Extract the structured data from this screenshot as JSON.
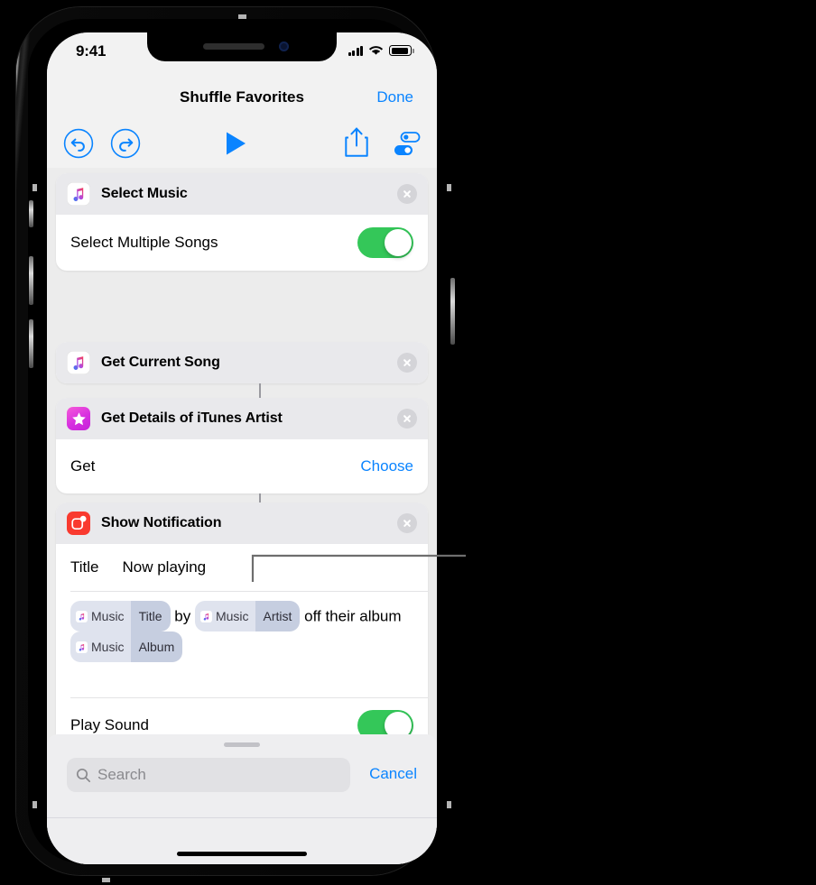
{
  "status_bar": {
    "time": "9:41",
    "cellular_icon": "cellular-signal-icon",
    "wifi_icon": "wifi-icon",
    "battery_icon": "battery-icon"
  },
  "nav": {
    "title": "Shuffle Favorites",
    "done_label": "Done"
  },
  "toolbar": {
    "undo_icon": "undo-icon",
    "redo_icon": "redo-icon",
    "play_icon": "play-icon",
    "share_icon": "share-icon",
    "settings_icon": "settings-toggles-icon",
    "accent_color": "#0a84ff"
  },
  "actions": [
    {
      "id": "select-music",
      "title": "Select Music",
      "icon": "apple-music-icon",
      "rows": [
        {
          "type": "toggle",
          "label": "Select Multiple Songs",
          "value": "on"
        }
      ]
    },
    {
      "id": "get-current-song",
      "title": "Get Current Song",
      "icon": "apple-music-icon",
      "rows": []
    },
    {
      "id": "get-details-itunes-artist",
      "title": "Get Details of iTunes Artist",
      "icon": "itunes-star-icon",
      "rows": [
        {
          "type": "link",
          "label": "Get",
          "link_label": "Choose"
        }
      ]
    },
    {
      "id": "show-notification",
      "title": "Show Notification",
      "icon": "notification-icon",
      "rows": [
        {
          "type": "title",
          "label": "Title",
          "value": "Now playing"
        },
        {
          "type": "toggle",
          "label": "Play Sound",
          "value": "on"
        }
      ]
    }
  ],
  "notification_body": {
    "tokens": [
      {
        "app": "Music",
        "field": "Title"
      },
      {
        "app": "Music",
        "field": "Artist"
      },
      {
        "app": "Music",
        "field": "Album"
      }
    ],
    "text_1": "by",
    "text_2": "off their",
    "text_3": "album"
  },
  "search": {
    "placeholder": "Search",
    "icon": "search-icon",
    "cancel_label": "Cancel"
  },
  "colors": {
    "accent": "#0a84ff",
    "toggle_on": "#34c759",
    "card_header": "#e9e9ec",
    "canvas": "#ececec",
    "token_app_bg": "#dfe3ee",
    "token_field_bg": "#c6cee0"
  }
}
